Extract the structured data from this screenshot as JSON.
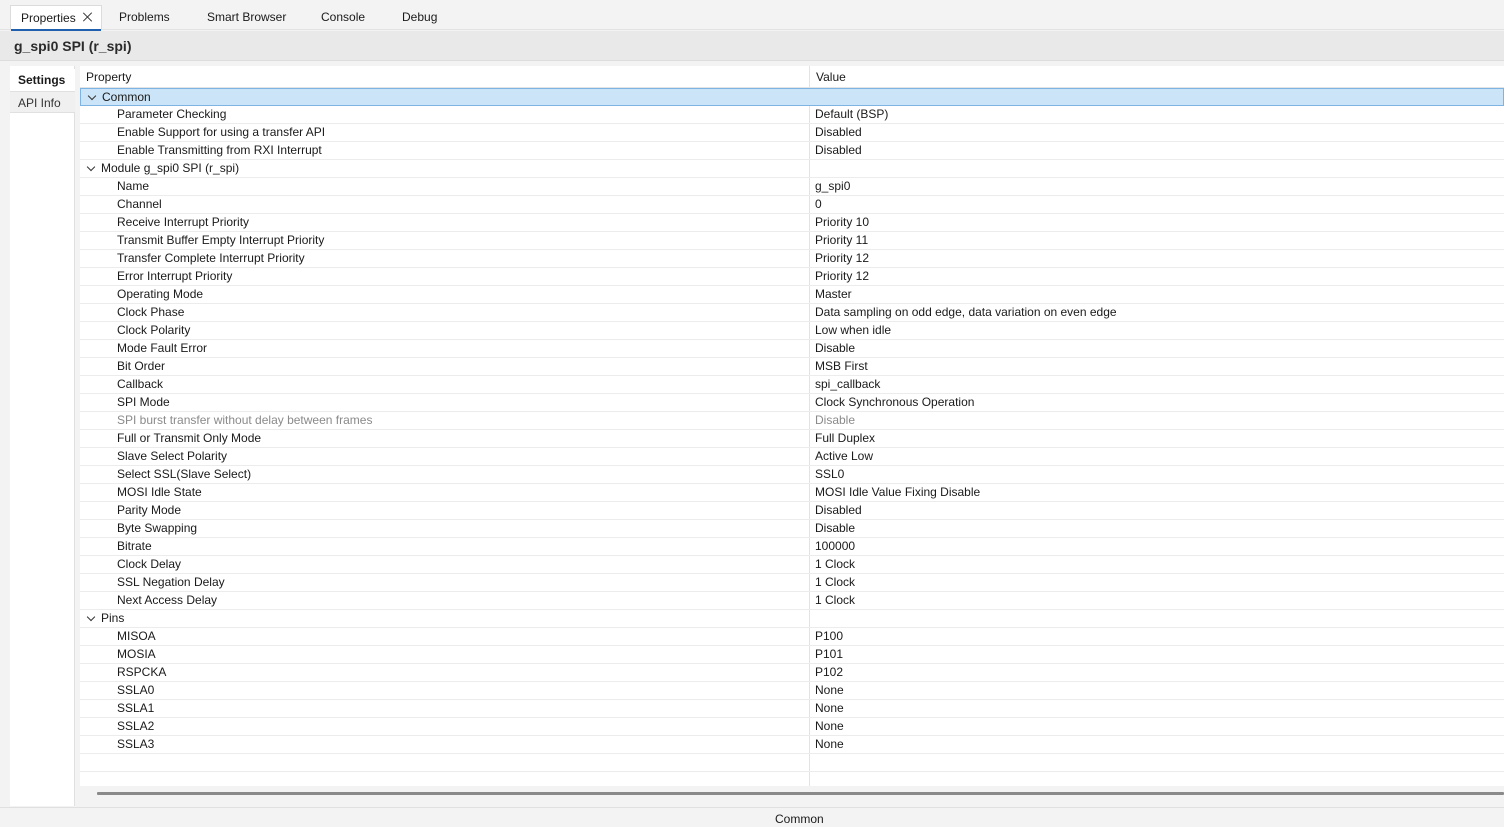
{
  "tabs": [
    {
      "label": "Properties",
      "active": true
    },
    {
      "label": "Problems"
    },
    {
      "label": "Smart Browser"
    },
    {
      "label": "Console"
    },
    {
      "label": "Debug"
    }
  ],
  "title": "g_spi0 SPI (r_spi)",
  "side_tabs": {
    "settings": "Settings",
    "api_info": "API Info"
  },
  "columns": {
    "property": "Property",
    "value": "Value"
  },
  "groups": {
    "common": {
      "label": "Common",
      "rows": [
        {
          "prop": "Parameter Checking",
          "val": "Default (BSP)"
        },
        {
          "prop": "Enable Support for using a transfer API",
          "val": "Disabled"
        },
        {
          "prop": "Enable Transmitting from RXI Interrupt",
          "val": "Disabled"
        }
      ]
    },
    "module": {
      "label": "Module g_spi0 SPI (r_spi)",
      "rows": [
        {
          "prop": "Name",
          "val": "g_spi0"
        },
        {
          "prop": "Channel",
          "val": "0"
        },
        {
          "prop": "Receive Interrupt Priority",
          "val": "Priority 10"
        },
        {
          "prop": "Transmit Buffer Empty Interrupt Priority",
          "val": "Priority 11"
        },
        {
          "prop": "Transfer Complete Interrupt Priority",
          "val": "Priority 12"
        },
        {
          "prop": "Error Interrupt Priority",
          "val": "Priority 12"
        },
        {
          "prop": "Operating Mode",
          "val": "Master"
        },
        {
          "prop": "Clock Phase",
          "val": "Data sampling on odd edge, data variation on even edge"
        },
        {
          "prop": "Clock Polarity",
          "val": "Low when idle"
        },
        {
          "prop": "Mode Fault Error",
          "val": "Disable"
        },
        {
          "prop": "Bit Order",
          "val": "MSB First"
        },
        {
          "prop": "Callback",
          "val": "spi_callback"
        },
        {
          "prop": "SPI Mode",
          "val": "Clock Synchronous Operation"
        },
        {
          "prop": "SPI burst transfer without delay between frames",
          "val": "Disable"
        },
        {
          "prop": "Full or Transmit Only Mode",
          "val": "Full Duplex"
        },
        {
          "prop": "Slave Select Polarity",
          "val": "Active Low"
        },
        {
          "prop": "Select SSL(Slave Select)",
          "val": "SSL0"
        },
        {
          "prop": "MOSI Idle State",
          "val": "MOSI Idle Value Fixing Disable"
        },
        {
          "prop": "Parity Mode",
          "val": "Disabled"
        },
        {
          "prop": "Byte Swapping",
          "val": "Disable"
        },
        {
          "prop": "Bitrate",
          "val": "100000"
        },
        {
          "prop": "Clock Delay",
          "val": "1 Clock"
        },
        {
          "prop": "SSL Negation Delay",
          "val": "1 Clock"
        },
        {
          "prop": "Next Access Delay",
          "val": "1 Clock"
        }
      ]
    },
    "pins": {
      "label": "Pins",
      "rows": [
        {
          "prop": "MISOA",
          "val": "P100"
        },
        {
          "prop": "MOSIA",
          "val": "P101"
        },
        {
          "prop": "RSPCKA",
          "val": "P102"
        },
        {
          "prop": "SSLA0",
          "val": "None"
        },
        {
          "prop": "SSLA1",
          "val": "None"
        },
        {
          "prop": "SSLA2",
          "val": "None"
        },
        {
          "prop": "SSLA3",
          "val": "None"
        }
      ]
    }
  },
  "status_text": "Common"
}
